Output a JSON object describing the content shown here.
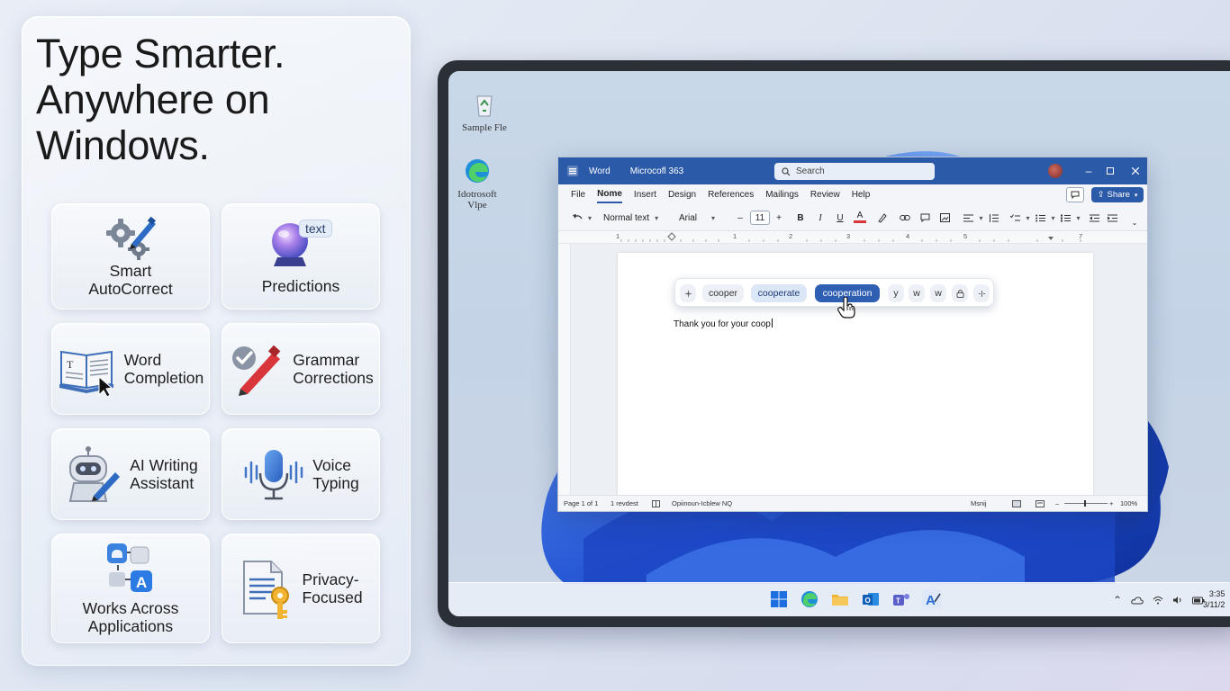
{
  "headline": {
    "line1": "Type Smarter.",
    "line2": "Anywhere on",
    "line3": "Windows."
  },
  "features": [
    {
      "label_lines": [
        "Smart",
        "AutoCorrect"
      ],
      "icon": "gear-pen-icon"
    },
    {
      "label_lines": [
        "Predictions"
      ],
      "icon": "crystal-ball-icon",
      "badge": "text"
    },
    {
      "label_lines": [
        "Word",
        "Completion"
      ],
      "icon": "open-book-icon"
    },
    {
      "label_lines": [
        "Grammar",
        "Corrections"
      ],
      "icon": "check-pen-icon"
    },
    {
      "label_lines": [
        "AI Writing",
        "Assistant"
      ],
      "icon": "robot-icon"
    },
    {
      "label_lines": [
        "Voice",
        "Typing"
      ],
      "icon": "microphone-icon"
    },
    {
      "label_lines": [
        "Works Across",
        "Applications"
      ],
      "icon": "apps-icon"
    },
    {
      "label_lines": [
        "Privacy-",
        "Focused"
      ],
      "icon": "document-key-icon"
    }
  ],
  "desktop": {
    "icons": [
      {
        "label": "Sample Fle",
        "icon": "recycle-bin-icon"
      },
      {
        "label": "Idotrosoft Vlpe",
        "icon": "edge-icon"
      }
    ],
    "clock": {
      "time": "3:35",
      "date": "3/11/2"
    }
  },
  "word": {
    "title_app": "Word",
    "title_doc": "Microcofl 363",
    "search_placeholder": "Search",
    "menu": [
      "File",
      "Nome",
      "Insert",
      "Design",
      "References",
      "Mailings",
      "Review",
      "Help"
    ],
    "active_menu": "Nome",
    "share_label": "Share",
    "style_value": "Normal text",
    "font_value": "Arial",
    "font_size": "11",
    "bold": "B",
    "italic": "I",
    "underline": "U",
    "font_color": "A",
    "ruler_numbers": [
      "1",
      "1",
      "2",
      "3",
      "4",
      "5",
      "7"
    ],
    "document_text": "Thank you for your coop",
    "suggestions": [
      "cooper",
      "cooperate",
      "cooperation"
    ],
    "selected_suggestion": "cooperation",
    "extra_chips": [
      "y",
      "w",
      "w"
    ],
    "status": {
      "page": "Page 1 of 1",
      "words": "1 revdest",
      "language": "Opiinoun-Icblew NQ",
      "focus": "Msnij",
      "zoom": "100%"
    }
  },
  "colors": {
    "word_blue": "#2b5aa8",
    "suggestion_selected": "#2f5fb3",
    "accent_red": "#d8363a"
  }
}
